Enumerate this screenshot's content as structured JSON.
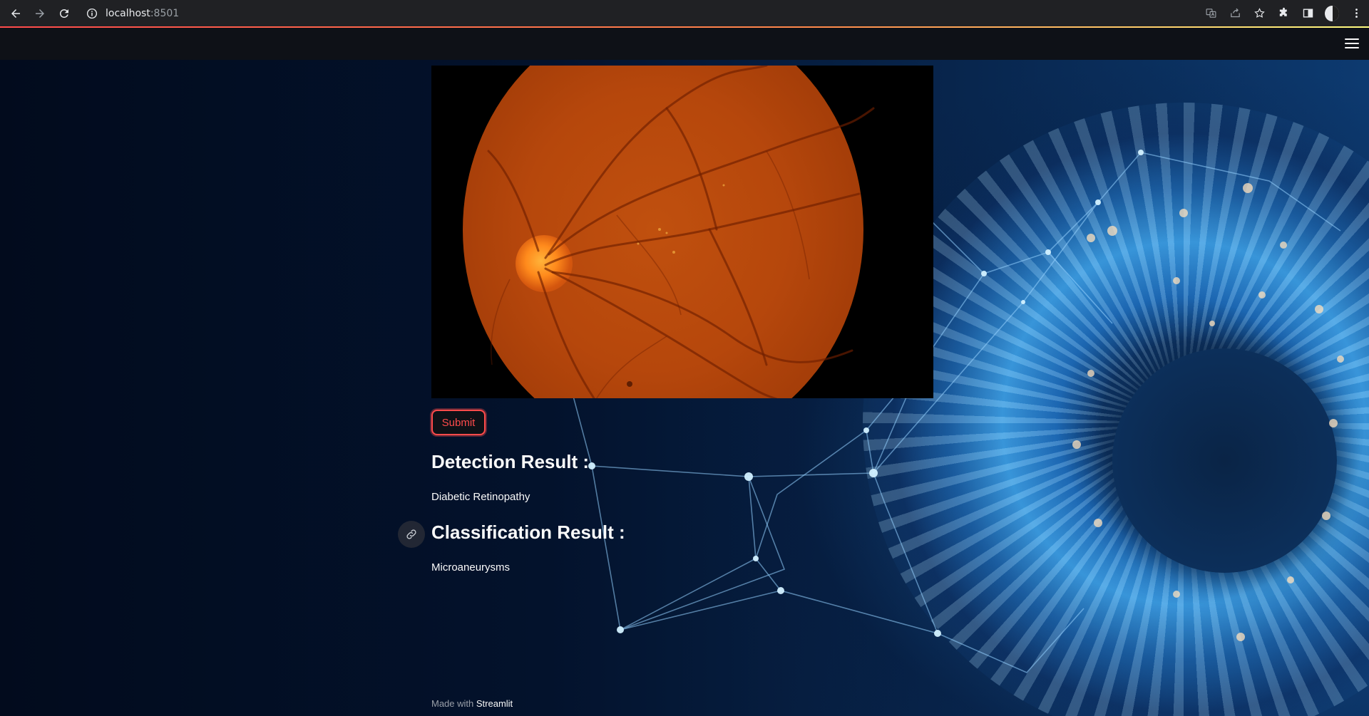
{
  "browser": {
    "url_host": "localhost",
    "url_port": ":8501"
  },
  "icons": {
    "back": "arrow-left-icon",
    "forward": "arrow-right-icon",
    "reload": "reload-icon",
    "site_info": "info-icon",
    "translate": "translate-icon",
    "share": "share-icon",
    "bookmark": "star-icon",
    "extensions": "puzzle-icon",
    "side_panel": "side-panel-icon",
    "profile": "profile-avatar-icon",
    "chrome_menu": "kebab-menu-icon",
    "app_menu": "hamburger-menu-icon",
    "anchor": "link-icon"
  },
  "colors": {
    "accent": "#ff4b4b",
    "header_bg": "#0e1117",
    "text": "#fafafa"
  },
  "main": {
    "submit_label": "Submit",
    "detection_heading": "Detection Result :",
    "detection_value": "Diabetic Retinopathy",
    "classification_heading": "Classification Result :",
    "classification_value": "Microaneurysms"
  },
  "footer": {
    "made_with": "Made with ",
    "brand": "Streamlit"
  }
}
